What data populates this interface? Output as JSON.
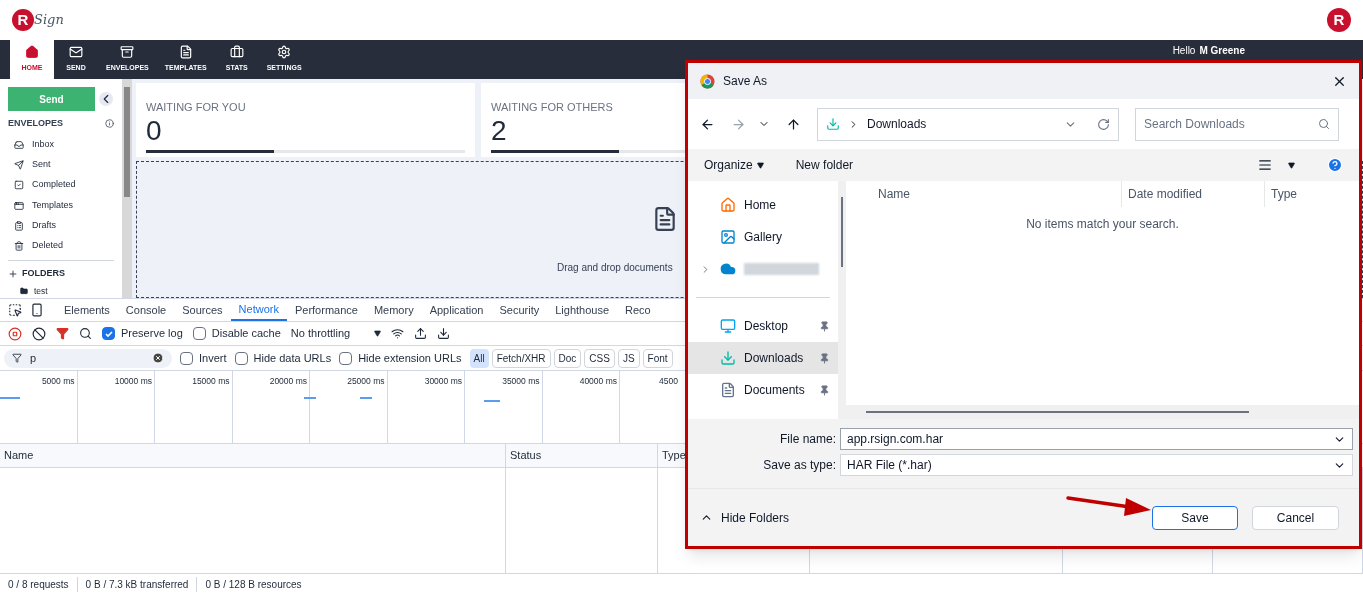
{
  "header": {
    "logo_letter": "R",
    "logo_word": "Sign",
    "corner_logo_letter": "R"
  },
  "nav": {
    "items": [
      {
        "label": "HOME",
        "selected": true
      },
      {
        "label": "SEND",
        "selected": false
      },
      {
        "label": "ENVELOPES",
        "selected": false
      },
      {
        "label": "TEMPLATES",
        "selected": false
      },
      {
        "label": "STATS",
        "selected": false
      },
      {
        "label": "SETTINGS",
        "selected": false
      }
    ],
    "greeting": "Hello",
    "user": "M Greene"
  },
  "sidebar": {
    "send_button": "Send",
    "envelopes_heading": "ENVELOPES",
    "items": [
      {
        "label": "Inbox"
      },
      {
        "label": "Sent"
      },
      {
        "label": "Completed"
      },
      {
        "label": "Templates"
      },
      {
        "label": "Drafts"
      },
      {
        "label": "Deleted"
      }
    ],
    "folders_heading": "FOLDERS",
    "folders": [
      {
        "label": "test"
      }
    ]
  },
  "dashboard": {
    "cards": [
      {
        "title": "WAITING FOR YOU",
        "count": "0",
        "level": 0.4
      },
      {
        "title": "WAITING FOR OTHERS",
        "count": "2",
        "level": 0.4
      }
    ],
    "drop_text": "Drag and drop documents"
  },
  "devtools": {
    "tabs": [
      {
        "label": "Elements",
        "selected": false
      },
      {
        "label": "Console",
        "selected": false
      },
      {
        "label": "Sources",
        "selected": false
      },
      {
        "label": "Network",
        "selected": true
      },
      {
        "label": "Performance",
        "selected": false
      },
      {
        "label": "Memory",
        "selected": false
      },
      {
        "label": "Application",
        "selected": false
      },
      {
        "label": "Security",
        "selected": false
      },
      {
        "label": "Lighthouse",
        "selected": false
      },
      {
        "label": "Reco",
        "selected": false
      }
    ],
    "preserve_log": {
      "label": "Preserve log",
      "checked": true
    },
    "disable_cache": {
      "label": "Disable cache",
      "checked": false
    },
    "throttling": "No throttling",
    "filter_value": "p",
    "filter_checks": [
      {
        "label": "Invert",
        "checked": false
      },
      {
        "label": "Hide data URLs",
        "checked": false
      },
      {
        "label": "Hide extension URLs",
        "checked": false
      }
    ],
    "type_filters": [
      {
        "label": "All",
        "selected": true
      },
      {
        "label": "Fetch/XHR",
        "selected": false
      },
      {
        "label": "Doc",
        "selected": false
      },
      {
        "label": "CSS",
        "selected": false
      },
      {
        "label": "JS",
        "selected": false
      },
      {
        "label": "Font",
        "selected": false
      }
    ],
    "timeline_ticks": [
      "5000 ms",
      "10000 ms",
      "15000 ms",
      "20000 ms",
      "25000 ms",
      "30000 ms",
      "35000 ms",
      "40000 ms",
      "4500"
    ],
    "columns": [
      "Name",
      "Status",
      "Type"
    ],
    "status_bar": [
      "0 / 8 requests",
      "0 B / 7.3 kB transferred",
      "0 B / 128 B resources"
    ]
  },
  "dialog": {
    "title": "Save As",
    "path": "Downloads",
    "search_placeholder": "Search Downloads",
    "organize": "Organize",
    "new_folder": "New folder",
    "nav_items": [
      {
        "kind": "place",
        "label": "Home",
        "selected": false
      },
      {
        "kind": "place",
        "label": "Gallery",
        "selected": false
      },
      {
        "kind": "redacted",
        "selected": false
      },
      {
        "kind": "place",
        "label": "Desktop",
        "selected": false,
        "pinned": true
      },
      {
        "kind": "place",
        "label": "Downloads",
        "selected": true,
        "pinned": true
      },
      {
        "kind": "place",
        "label": "Documents",
        "selected": false,
        "pinned": true
      }
    ],
    "columns": [
      "Name",
      "Date modified",
      "Type"
    ],
    "empty_text": "No items match your search.",
    "file_name_label": "File name:",
    "file_name": "app.rsign.com.har",
    "type_label": "Save as type:",
    "type_value": "HAR File (*.har)",
    "hide_folders": "Hide Folders",
    "save": "Save",
    "cancel": "Cancel"
  }
}
